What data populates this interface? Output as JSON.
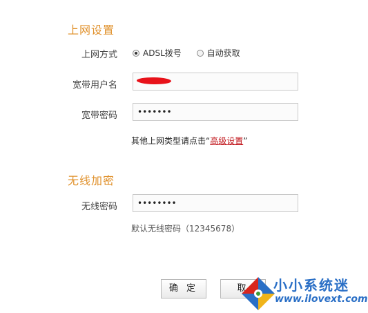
{
  "internet": {
    "section_title": "上网设置",
    "mode_label": "上网方式",
    "mode_options": [
      "ADSL拨号",
      "自动获取"
    ],
    "username_label": "宽带用户名",
    "username_value": "",
    "password_label": "宽带密码",
    "password_value": "•••••••",
    "hint_prefix": "其他上网类型请点击“",
    "hint_link": "高级设置",
    "hint_suffix": "”"
  },
  "wireless": {
    "section_title": "无线加密",
    "password_label": "无线密码",
    "password_value": "••••••••",
    "default_note": "默认无线密码（12345678）"
  },
  "buttons": {
    "confirm": "确 定",
    "cancel": "取"
  },
  "watermark": {
    "text": "小小系统迷",
    "url": "www.ilovext.com",
    "colors": [
      "#2a6fc6",
      "#d8261e",
      "#3a9a3a",
      "#f0b41a"
    ]
  }
}
